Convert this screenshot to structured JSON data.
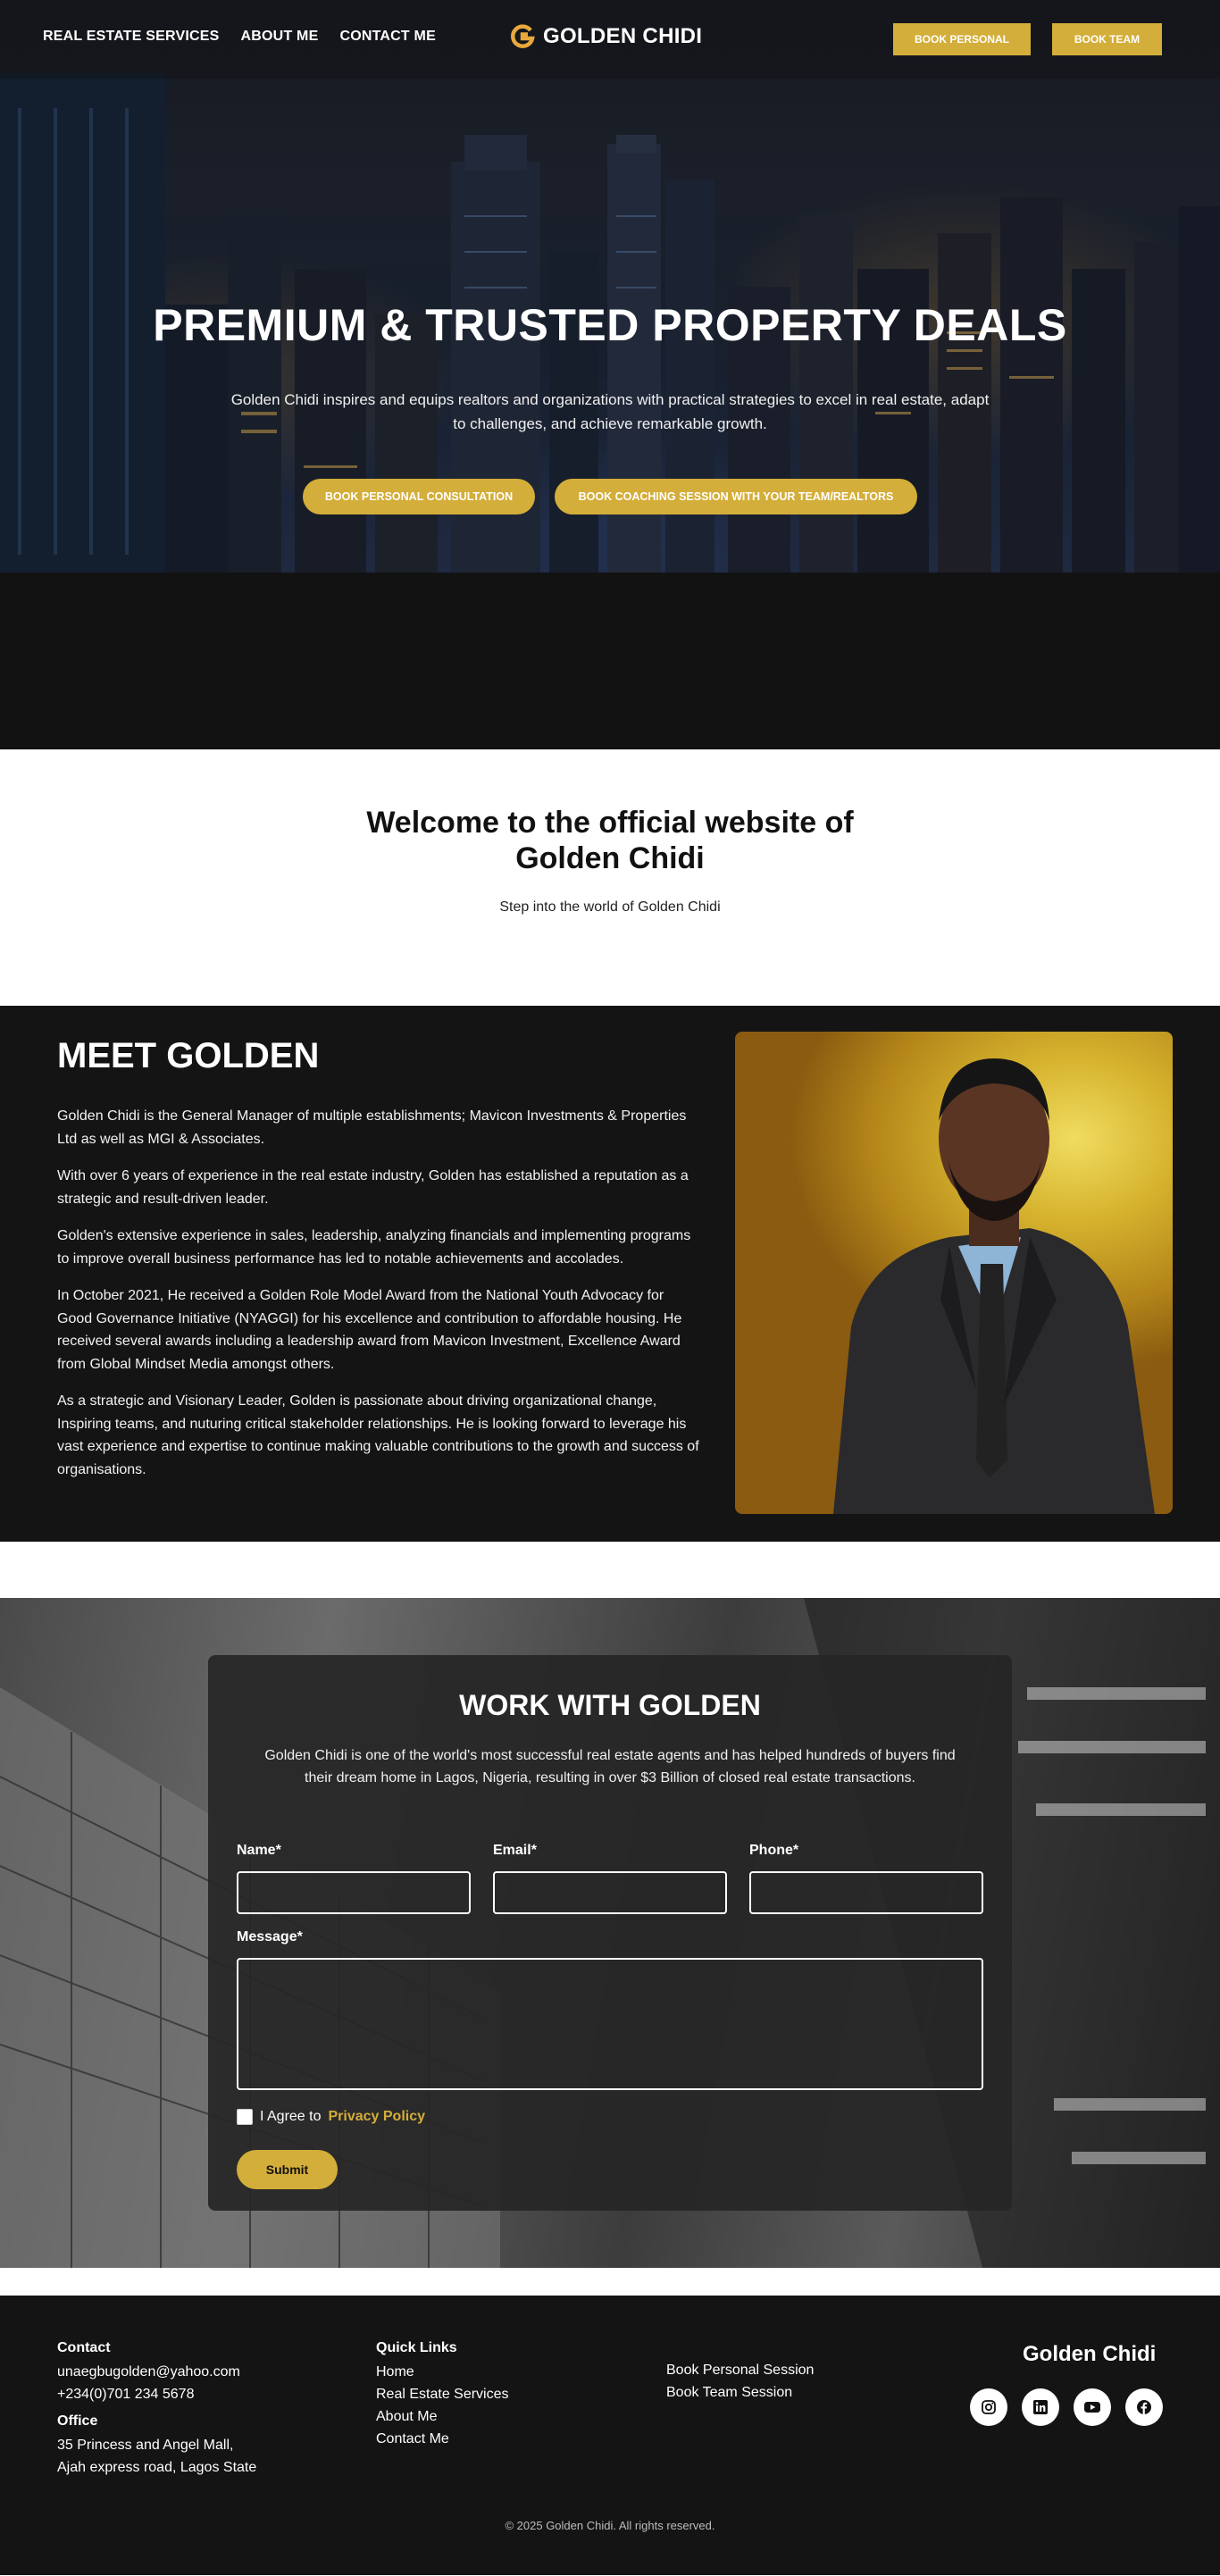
{
  "nav": {
    "links": [
      "REAL ESTATE SERVICES",
      "ABOUT ME",
      "CONTACT ME"
    ],
    "logo_text": "GOLDEN CHIDI",
    "book_personal": "BOOK PERSONAL",
    "book_team": "BOOK TEAM"
  },
  "hero": {
    "title": "PREMIUM & TRUSTED PROPERTY DEALS",
    "subtitle": "Golden Chidi inspires and equips realtors and organizations with practical strategies to excel in real estate, adapt to challenges, and achieve remarkable growth.",
    "cta_personal": "BOOK PERSONAL CONSULTATION",
    "cta_team": "BOOK COACHING SESSION WITH YOUR TEAM/REALTORS"
  },
  "welcome": {
    "title": "Welcome to the official website of Golden Chidi",
    "subtitle": "Step into the world of Golden Chidi"
  },
  "meet": {
    "title": "MEET GOLDEN",
    "paragraphs": [
      "Golden Chidi is the General Manager of multiple establishments; Mavicon Investments & Properties Ltd as well as MGI & Associates.",
      "With over 6 years of experience in the real estate industry, Golden has established a reputation as a strategic and result-driven leader.",
      "Golden's extensive experience in sales, leadership, analyzing financials and implementing programs to improve overall business performance has led to notable achievements and accolades.",
      "In October 2021, He received a Golden Role Model Award from the National Youth Advocacy for Good Governance Initiative (NYAGGI) for his excellence and contribution to affordable housing. He received several awards including a leadership award from Mavicon Investment, Excellence Award from Global Mindset Media amongst others.",
      "As a strategic and Visionary Leader, Golden is passionate about driving organizational change, Inspiring teams, and nuturing critical stakeholder relationships. He is looking forward to leverage his vast experience and expertise to continue making valuable contributions to the growth and success of organisations."
    ]
  },
  "work": {
    "title": "WORK WITH GOLDEN",
    "description": "Golden Chidi is one of the world's most successful real estate agents and has helped hundreds of buyers find their dream home in Lagos, Nigeria, resulting in over $3 Billion of closed real estate transactions.",
    "name_label": "Name*",
    "email_label": "Email*",
    "phone_label": "Phone*",
    "message_label": "Message*",
    "name_value": "",
    "email_value": "",
    "phone_value": "",
    "message_value": "",
    "agree_text": "I Agree to",
    "privacy_link": "Privacy Policy",
    "submit_label": "Submit"
  },
  "footer": {
    "contact_heading": "Contact",
    "email": "unaegbugolden@yahoo.com",
    "phone": "+234(0)701 234 5678",
    "office_heading": "Office",
    "address_line1": "35 Princess and Angel Mall,",
    "address_line2": "Ajah express road, Lagos State",
    "quick_links_heading": "Quick Links",
    "quick_links": [
      "Home",
      "Real Estate Services",
      "About Me",
      "Contact Me"
    ],
    "sessions": [
      "Book Personal Session",
      "Book Team Session"
    ],
    "brand": "Golden Chidi",
    "socials": [
      "instagram-icon",
      "linkedin-icon",
      "youtube-icon",
      "facebook-icon"
    ],
    "copyright": "© 2025 Golden Chidi. All rights reserved."
  },
  "colors": {
    "accent": "#d4ae3a",
    "dark": "#141414"
  }
}
